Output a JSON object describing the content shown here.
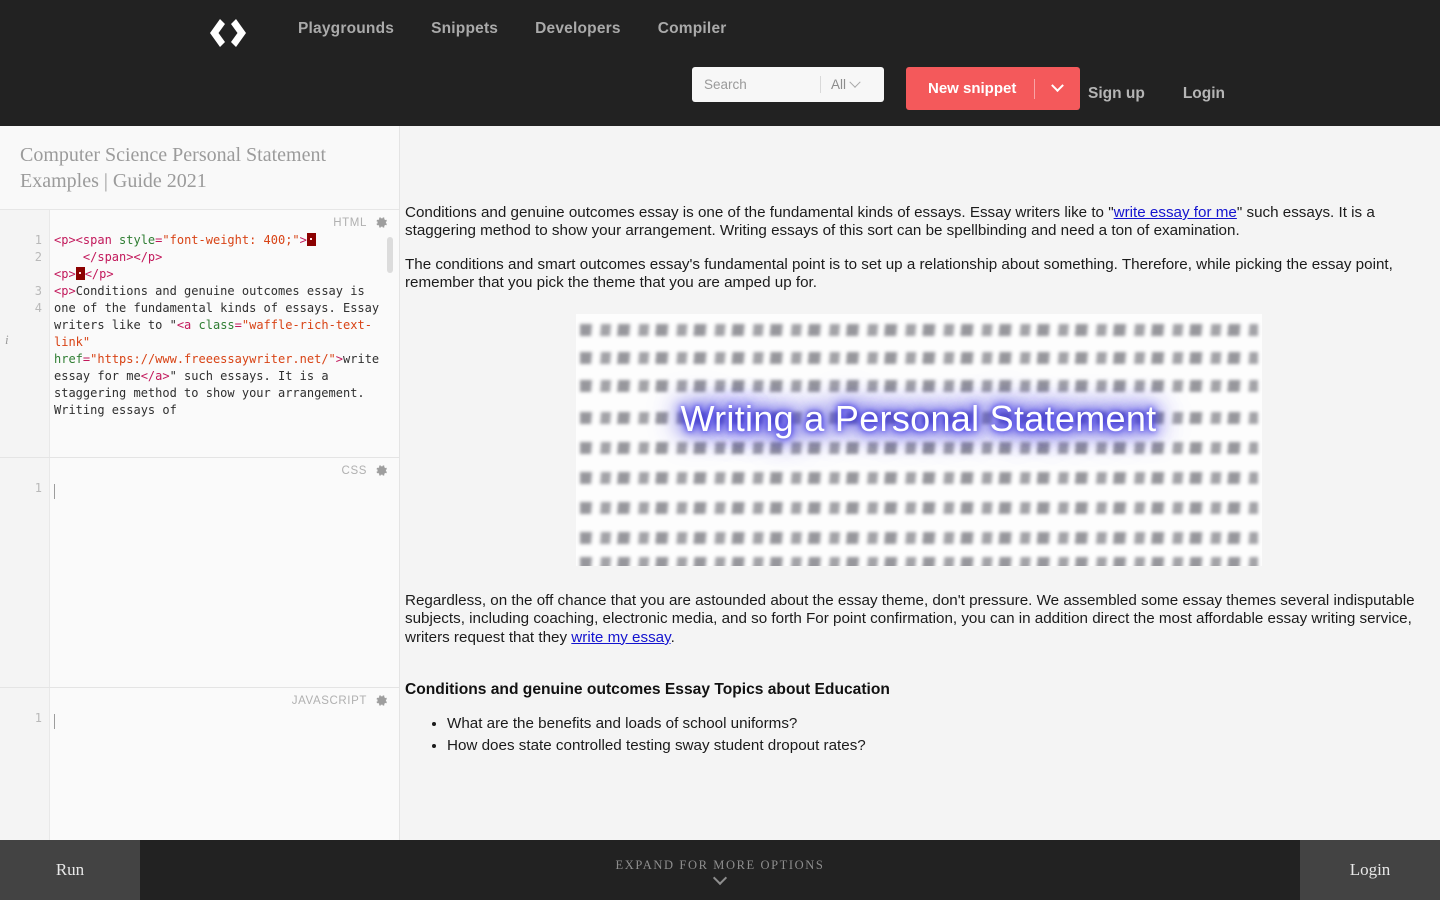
{
  "header": {
    "logo_icon": "code-brackets-logo",
    "nav": [
      {
        "label": "Playgrounds"
      },
      {
        "label": "Snippets"
      },
      {
        "label": "Developers"
      },
      {
        "label": "Compiler"
      }
    ],
    "search": {
      "placeholder": "Search",
      "value": "",
      "filter_label": "All",
      "filter_icon": "chevron-down-icon",
      "icon": "search-icon"
    },
    "new_snippet": {
      "label": "New snippet",
      "caret_icon": "chevron-down-icon",
      "color": "#f4595b"
    },
    "auth": [
      {
        "label": "Sign up"
      },
      {
        "label": "Login"
      }
    ]
  },
  "editor": {
    "snippet_title": "Computer Science Personal Statement Examples | Guide 2021",
    "info_icon": "info-icon",
    "panes": [
      {
        "label": "HTML",
        "gear_icon": "gear-icon",
        "line_numbers": "1\n2\n\n3\n4",
        "code_plain": "<p><span style=\"font-weight: 400;\"> </span></p>\n<p> </p>\n<p>Conditions and genuine outcomes essay is one of the fundamental kinds of essays. Essay writers like to \"<a class=\"waffle-rich-text-link\" href=\"https://www.freeessaywriter.net/\">write essay for me</a>\" such essays. It is a staggering method to show your arrangement. Writing essays of"
      },
      {
        "label": "CSS",
        "gear_icon": "gear-icon",
        "line_numbers": "1",
        "code_plain": ""
      },
      {
        "label": "JAVASCRIPT",
        "gear_icon": "gear-icon",
        "line_numbers": "1",
        "code_plain": ""
      }
    ]
  },
  "preview": {
    "paragraph_1_before": "Conditions and genuine outcomes essay is one of the fundamental kinds of essays. Essay writers like to \"",
    "paragraph_1_link": "write essay for me",
    "paragraph_1_after": "\" such essays. It is a staggering method to show your arrangement. Writing essays of this sort can be spellbinding and need a ton of examination.",
    "paragraph_2": "The conditions and smart outcomes essay's fundamental point is to set up a relationship about something. Therefore, while picking the essay point, remember that you pick the theme that you are amped up for.",
    "image": {
      "caption": "Writing a Personal Statement",
      "alt": "handwritten personal statement page",
      "caption_glow_color": "#3b35d8"
    },
    "paragraph_3_before": "Regardless, on the off chance that you are astounded about the essay theme, don't pressure. We assembled some essay themes several indisputable subjects, including coaching, electronic media, and so forth For point confirmation, you can in addition direct the most affordable essay writing service, writers request that they ",
    "paragraph_3_link": "write my essay",
    "paragraph_3_after": ".",
    "heading": "Conditions and genuine outcomes Essay Topics about Education",
    "bullets": [
      "What are the benefits and loads of school uniforms?",
      "How does state controlled testing sway student dropout rates?"
    ]
  },
  "bottom_bar": {
    "run_label": "Run",
    "expand_label": "EXPAND FOR MORE OPTIONS",
    "expand_icon": "chevron-down-icon",
    "login_label": "Login"
  }
}
